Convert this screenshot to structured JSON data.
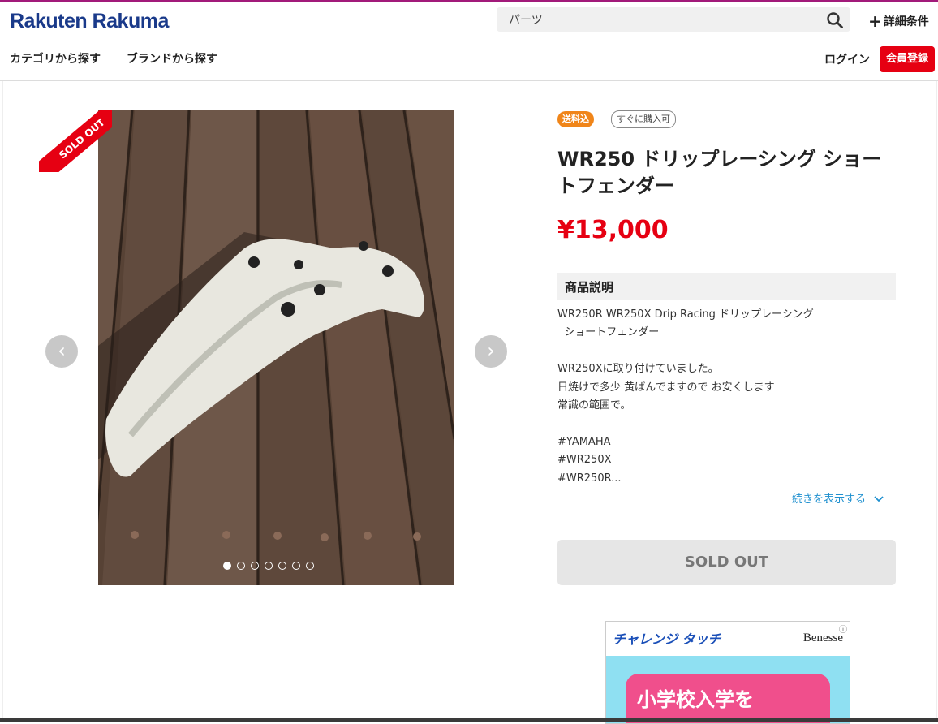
{
  "header": {
    "logo": "Rakuten Rakuma",
    "search_value": "パーツ",
    "advanced_search": "詳細条件",
    "nav_category": "カテゴリから探す",
    "nav_brand": "ブランドから探す",
    "login": "ログイン",
    "signup": "会員登録"
  },
  "gallery": {
    "sold_ribbon": "SOLD OUT",
    "prev_icon": "chevron-left",
    "next_icon": "chevron-right",
    "slides": 7,
    "active_slide": 1
  },
  "product": {
    "badge_shipping": "送料込",
    "badge_buy": "すぐに購入可",
    "title": "WR250 ドリップレーシング ショートフェンダー",
    "price": "¥13,000",
    "description_heading": "商品説明",
    "description_lines": [
      "WR250R WR250X Drip Racing ドリップレーシング",
      "  ショートフェンダー",
      "",
      "WR250Xに取り付けていました。",
      "日焼けで多少 黄ばんでますので お安くします",
      "常識の範囲で。",
      "",
      "#YAMAHA",
      "#WR250X",
      "#WR250R..."
    ],
    "show_more": "続きを表示する",
    "sold_button": "SOLD OUT"
  },
  "ad": {
    "brand": "チャレンジ タッチ",
    "advertiser": "Benesse",
    "headline": "小学校入学を"
  },
  "colors": {
    "brand_red": "#e60012",
    "price_red": "#e60012",
    "logo_blue": "#1a3a8a",
    "link_blue": "#1d8fcf",
    "badge_orange": "#f08519"
  }
}
